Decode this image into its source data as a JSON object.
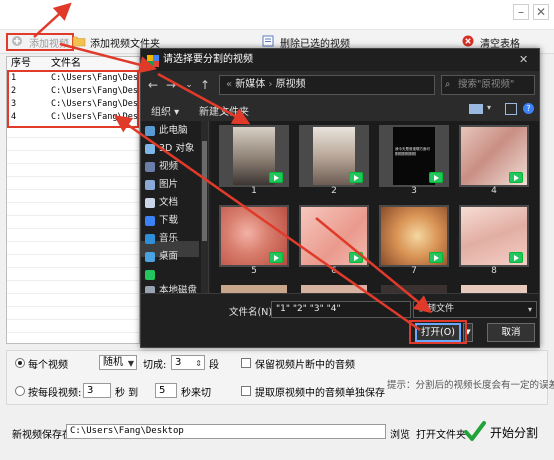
{
  "toolbar": {
    "add_video": "添加视频",
    "add_folder": "添加视频文件夹",
    "delete_selected": "删除已选的视频",
    "clear_table": "清空表格"
  },
  "table": {
    "headers": [
      "序号",
      "文件名"
    ],
    "rows": [
      {
        "n": "1",
        "path": "C:\\Users\\Fang\\Desktop"
      },
      {
        "n": "2",
        "path": "C:\\Users\\Fang\\Desktop"
      },
      {
        "n": "3",
        "path": "C:\\Users\\Fang\\Desktop"
      },
      {
        "n": "4",
        "path": "C:\\Users\\Fang\\Desktop"
      }
    ]
  },
  "options": {
    "per_video": "每个视频",
    "random": "随机",
    "cut_into": "切成:",
    "segments_value": "3",
    "segments_unit": "段",
    "by_segment": "按每段视频:",
    "from_value": "3",
    "sec": "秒 到",
    "to_value": "5",
    "sec_cut": "秒来切",
    "keep_audio": "保留视频片断中的音频",
    "extract_audio": "提取原视频中的音频单独保存",
    "hint": "提示：分割后的视频长度会有一定的误差。"
  },
  "save": {
    "label": "新视频保存在:",
    "path": "C:\\Users\\Fang\\Desktop",
    "browse": "浏览",
    "open_folder": "打开文件夹",
    "start": "开始分割"
  },
  "dialog": {
    "title": "请选择要分割的视频",
    "breadcrumb": [
      "新媒体",
      "原视频"
    ],
    "search_placeholder": "搜索\"原视频\"",
    "organize": "组织 ▾",
    "new_folder": "新建文件夹",
    "nav_items": [
      "此电脑",
      "3D 对象",
      "视频",
      "图片",
      "文档",
      "下载",
      "音乐",
      "桌面",
      "",
      "本地磁盘"
    ],
    "thumbs": [
      "1",
      "2",
      "3",
      "4",
      "5",
      "6",
      "7",
      "8"
    ],
    "thumb3_caption": "我今天是谁谁哪方面可\n刚刚刚刚刚刚",
    "filename_label": "文件名(N):",
    "filename_value": "\"1\" \"2\" \"3\" \"4\"",
    "filetype": "视频文件",
    "open": "打开(O)",
    "cancel": "取消"
  },
  "colors": {
    "accent_red": "#e03b2a",
    "dialog_bg": "#202020",
    "play_badge": "#22c55e",
    "start_check": "#22a33a"
  }
}
